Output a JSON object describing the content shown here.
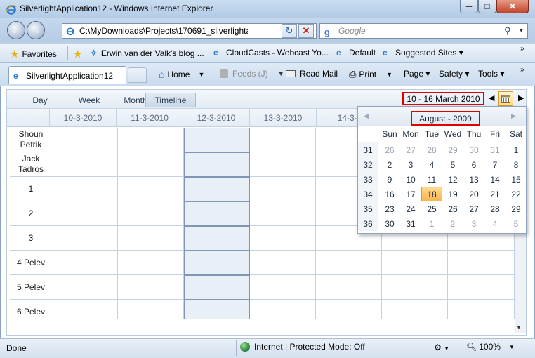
{
  "window": {
    "title": "SilverlightApplication12 - Windows Internet Explorer"
  },
  "address": {
    "url": "C:\\MyDownloads\\Projects\\170691_silverlightapplic",
    "search_placeholder": "Google"
  },
  "favorites": {
    "label": "Favorites",
    "items": [
      "Erwin van der Valk's blog ...",
      "CloudCasts - Webcast Yo...",
      "Default",
      "Suggested Sites ▾"
    ]
  },
  "tabs": {
    "active": "SilverlightApplication12"
  },
  "commands": {
    "home": "Home",
    "feeds": "Feeds (J)",
    "read_mail": "Read Mail",
    "print": "Print",
    "page": "Page ▾",
    "safety": "Safety ▾",
    "tools": "Tools ▾"
  },
  "scheduler": {
    "views": [
      "Day",
      "Week",
      "Month",
      "Timeline"
    ],
    "active_view": "Timeline",
    "date_range": "10 - 16 March 2010",
    "columns": [
      "10-3-2010",
      "11-3-2010",
      "12-3-2010",
      "13-3-2010",
      "14-3-2"
    ],
    "rows": [
      "Shoun\nPetrik",
      "Jack\nTadros",
      "1",
      "2",
      "3",
      "4 Pelev",
      "5 Pelev",
      "6 Pelev"
    ]
  },
  "calendar": {
    "month_label": "August - 2009",
    "weekdays": [
      "Sun",
      "Mon",
      "Tue",
      "Wed",
      "Thu",
      "Fri",
      "Sat"
    ],
    "weeks": [
      {
        "wk": "31",
        "days": [
          "26",
          "27",
          "28",
          "29",
          "30",
          "31",
          "1"
        ]
      },
      {
        "wk": "32",
        "days": [
          "2",
          "3",
          "4",
          "5",
          "6",
          "7",
          "8"
        ]
      },
      {
        "wk": "33",
        "days": [
          "9",
          "10",
          "11",
          "12",
          "13",
          "14",
          "15"
        ]
      },
      {
        "wk": "34",
        "days": [
          "16",
          "17",
          "18",
          "19",
          "20",
          "21",
          "22"
        ]
      },
      {
        "wk": "35",
        "days": [
          "23",
          "24",
          "25",
          "26",
          "27",
          "28",
          "29"
        ]
      },
      {
        "wk": "36",
        "days": [
          "30",
          "31",
          "1",
          "2",
          "3",
          "4",
          "5"
        ]
      }
    ],
    "selected_day": "18"
  },
  "status": {
    "left": "Done",
    "zone": "Internet | Protected Mode: Off",
    "zoom": "100%"
  }
}
